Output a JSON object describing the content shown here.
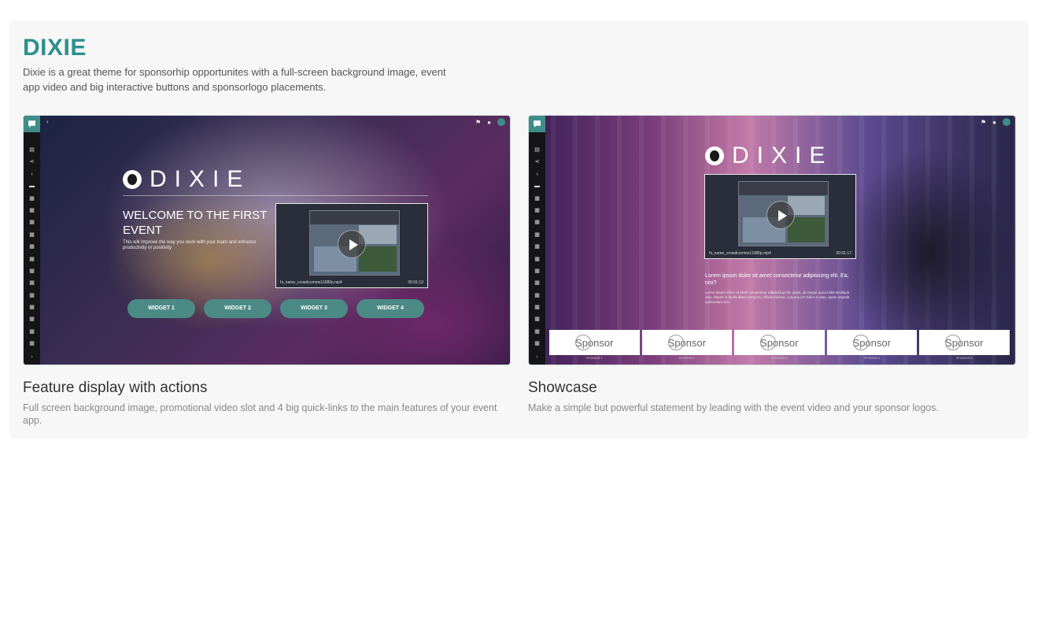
{
  "theme": {
    "title": "DIXIE",
    "description": "Dixie is a great theme for sponsorhip opportunites with a full-screen background image, event app video and big interactive buttons and sponsorlogo placements."
  },
  "cards": [
    {
      "title": "Feature display with actions",
      "description": "Full screen background image, promotional video slot and 4 big quick-links to the main features of your event app.",
      "preview": {
        "logo_text": "DIXIE",
        "welcome": "WELCOME TO THE FIRST EVENT",
        "welcome_sub": "This will improve the way you work with your team and enhance productivity or positivity",
        "video_file": "hi_name_crowdcomms11080p.mp4",
        "video_time": "00:01:13",
        "widgets": [
          "WIDGET 1",
          "WIDGET 2",
          "WIDGET 3",
          "WIDGET 4"
        ]
      }
    },
    {
      "title": "Showcase",
      "description": "Make a simple but powerful statement by leading with the event video and your sponsor logos.",
      "preview": {
        "logo_text": "DIXIE",
        "video_file": "hi_name_crowdcomms11080p.mp4",
        "video_time": "00:01:17",
        "lorem": "Lorem ipsum dolor sit amet consectetur adipisicing elit. Ea, nisi?",
        "lorem_small": "Lorem ipsum dolor sit amet consectetur adipisicing elit. Quas, ab neque quod nulla similique odio, labore in facilis libero tempora, officiis minima, corporis in? Dolor a vitae, quam impedit quibusdam eos.",
        "sponsors": [
          "Sponsor",
          "Sponsor",
          "Sponsor",
          "Sponsor",
          "Sponsor"
        ],
        "sponsor_labels": [
          "SPONSOR 1",
          "SPONSOR 2",
          "SPONSOR 3",
          "SPONSOR 4",
          "SPONSOR 5"
        ]
      }
    }
  ],
  "colors": {
    "accent": "#2f8f8f",
    "widget": "#4c8a86",
    "sidebar": "#151517"
  },
  "icons": {
    "brand": "chat-bubble-icon",
    "topbar": [
      "flag-icon",
      "bell-icon",
      "avatar"
    ],
    "sidebar": [
      "calendar-icon",
      "share-icon",
      "chevron-left-icon",
      "list-icon"
    ]
  }
}
